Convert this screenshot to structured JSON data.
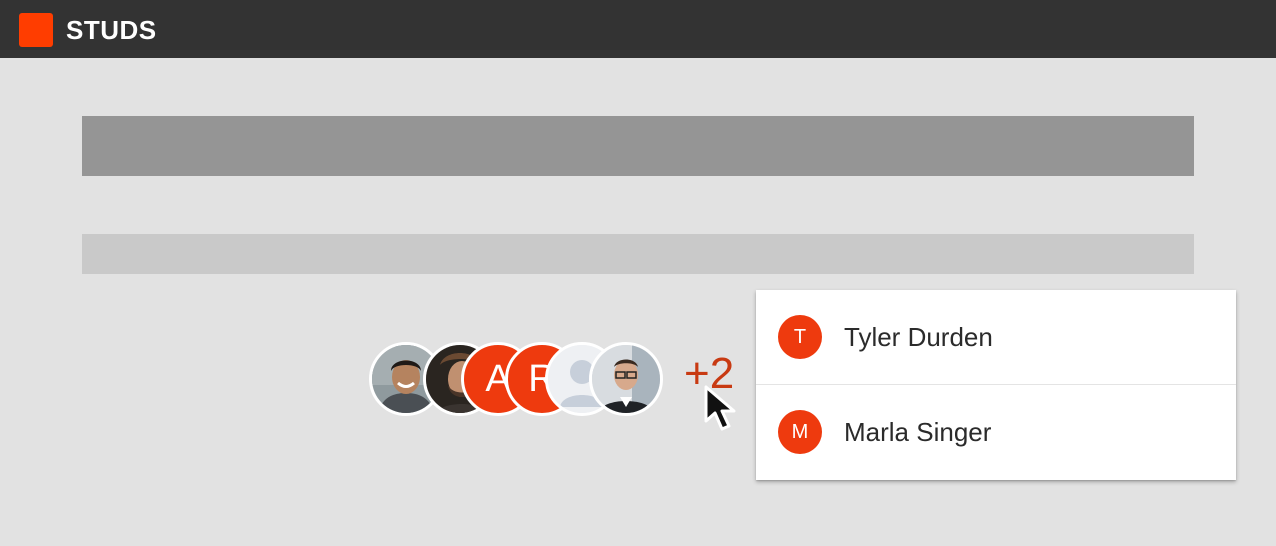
{
  "app": {
    "title": "STUDS",
    "brand_color": "#ff3d00"
  },
  "avatar_group": {
    "avatars": [
      {
        "type": "photo",
        "icon": "person-photo-smiling-man"
      },
      {
        "type": "photo",
        "icon": "person-photo-bearded-man"
      },
      {
        "type": "initial",
        "initial": "A"
      },
      {
        "type": "initial",
        "initial": "R"
      },
      {
        "type": "placeholder",
        "icon": "default-user-icon"
      },
      {
        "type": "photo",
        "icon": "person-photo-man-glasses"
      }
    ],
    "overflow_label": "+2"
  },
  "overflow_menu": {
    "items": [
      {
        "initial": "T",
        "name": "Tyler Durden"
      },
      {
        "initial": "M",
        "name": "Marla Singer"
      }
    ]
  },
  "colors": {
    "accent": "#ee3a0e",
    "overflow_text": "#c83a12",
    "topbar": "#333333"
  }
}
